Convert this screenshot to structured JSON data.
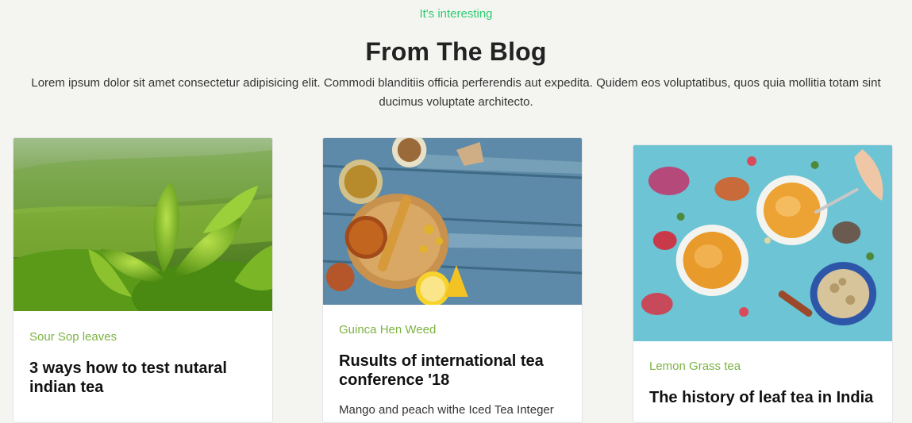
{
  "section": {
    "eyebrow": "It's interesting",
    "title": "From The Blog",
    "subtitle": "Lorem ipsum dolor sit amet consectetur adipisicing elit. Commodi blanditiis officia perferendis aut expedita. Quidem eos voluptatibus, quos quia mollitia totam sint ducimus voluptate architecto."
  },
  "posts": [
    {
      "category": "Sour Sop leaves",
      "title": "3 ways how to test nutaral indian tea",
      "excerpt": "",
      "image": "tea-plantation-image"
    },
    {
      "category": "Guinca Hen Weed",
      "title": "Rusults of international tea conference '18",
      "excerpt": "Mango and peach withe Iced Tea Integer",
      "image": "tea-table-image"
    },
    {
      "category": "Lemon Grass tea",
      "title": "The history of leaf tea in India",
      "excerpt": "",
      "image": "herbal-tea-cups-image"
    }
  ],
  "colors": {
    "accent_green": "#2ecc71",
    "category_green": "#7cb342",
    "background": "#f4f5f1"
  }
}
